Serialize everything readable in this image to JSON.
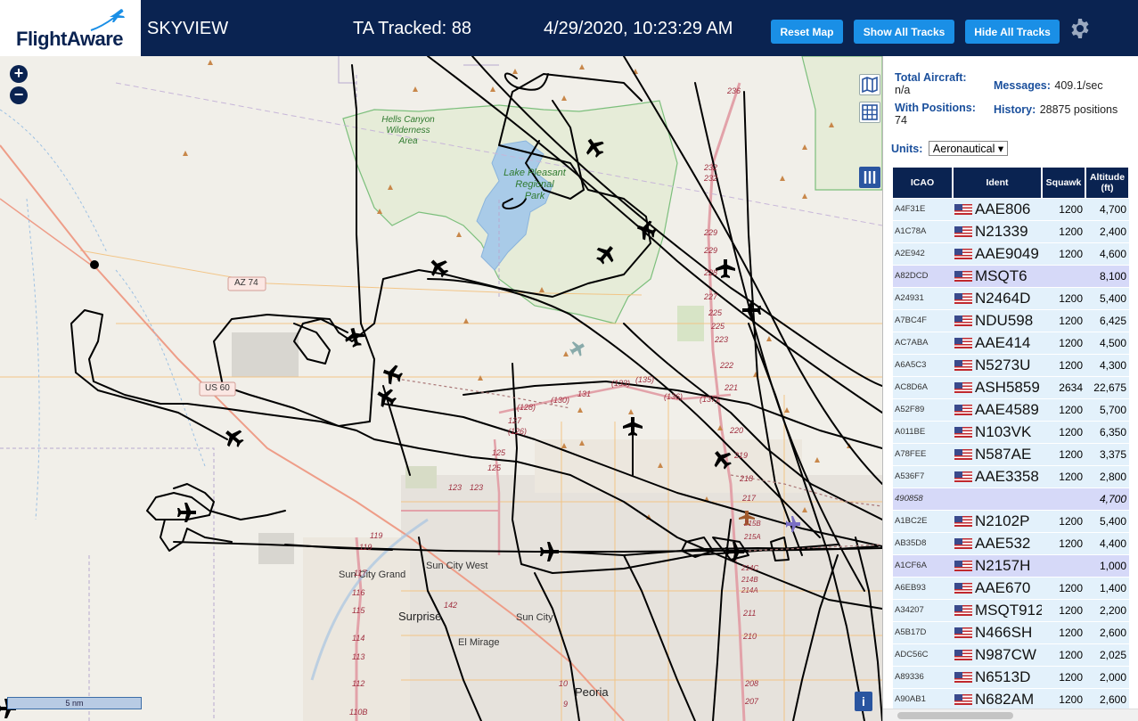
{
  "header": {
    "logo": "FlightAware",
    "title": "SKYVIEW",
    "ta_tracked": "TA Tracked: 88",
    "datetime": "4/29/2020, 10:23:29 AM",
    "reset_map": "Reset Map",
    "show_all_tracks": "Show All Tracks",
    "hide_all_tracks": "Hide All Tracks",
    "settings_icon": "gear-icon"
  },
  "map": {
    "zoom_in": "+",
    "zoom_out": "−",
    "scale_label": "5 nm",
    "info": "i",
    "labels": {
      "hells_canyon_1": "Hells Canyon",
      "hells_canyon_2": "Wilderness",
      "hells_canyon_3": "Area",
      "lake_1": "Lake Pleasant",
      "lake_2": "Regional",
      "lake_3": "Park",
      "az74": "AZ 74",
      "us60": "US 60",
      "sun_city_west": "Sun City West",
      "sun_city_grand": "Sun City Grand",
      "surprise": "Surprise",
      "sun_city": "Sun City",
      "el_mirage": "El Mirage",
      "peoria": "Peoria"
    },
    "road_numbers": [
      "236",
      "232",
      "232",
      "229",
      "229",
      "228",
      "227",
      "225",
      "225",
      "223",
      "222",
      "221",
      "220",
      "219",
      "218",
      "217",
      "215B",
      "215A",
      "214C",
      "214B",
      "214A",
      "211",
      "210",
      "208",
      "207",
      "131",
      "(130)",
      "(133)",
      "(135)",
      "(136)",
      "(137)",
      "(128)",
      "127",
      "(126)",
      "125",
      "125",
      "123",
      "123",
      "119",
      "119",
      "117",
      "116",
      "115",
      "114",
      "113",
      "112",
      "110B",
      "142",
      "10",
      "9"
    ]
  },
  "sidebar": {
    "total_aircraft_label": "Total Aircraft:",
    "total_aircraft_value": "n/a",
    "with_positions_label": "With Positions:",
    "with_positions_value": "74",
    "messages_label": "Messages:",
    "messages_value": "409.1/sec",
    "history_label": "History:",
    "history_value": "28875 positions",
    "units_label": "Units:",
    "units_value": "Aeronautical"
  },
  "table": {
    "columns": [
      "ICAO",
      "Ident",
      "Squawk",
      "Altitude (ft)"
    ],
    "rows": [
      {
        "icao": "A4F31E",
        "ident": "AAE806",
        "squawk": "1200",
        "alt": "4,700"
      },
      {
        "icao": "A1C78A",
        "ident": "N21339",
        "squawk": "1200",
        "alt": "2,400"
      },
      {
        "icao": "A2E942",
        "ident": "AAE9049",
        "squawk": "1200",
        "alt": "4,600"
      },
      {
        "icao": "A82DCD",
        "ident": "MSQT6",
        "squawk": "",
        "alt": "8,100"
      },
      {
        "icao": "A24931",
        "ident": "N2464D",
        "squawk": "1200",
        "alt": "5,400"
      },
      {
        "icao": "A7BC4F",
        "ident": "NDU598",
        "squawk": "1200",
        "alt": "6,425"
      },
      {
        "icao": "AC7ABA",
        "ident": "AAE414",
        "squawk": "1200",
        "alt": "4,500"
      },
      {
        "icao": "A6A5C3",
        "ident": "N5273U",
        "squawk": "1200",
        "alt": "4,300"
      },
      {
        "icao": "AC8D6A",
        "ident": "ASH5859",
        "squawk": "2634",
        "alt": "22,675"
      },
      {
        "icao": "A52F89",
        "ident": "AAE4589",
        "squawk": "1200",
        "alt": "5,700"
      },
      {
        "icao": "A011BE",
        "ident": "N103VK",
        "squawk": "1200",
        "alt": "6,350"
      },
      {
        "icao": "A78FEE",
        "ident": "N587AE",
        "squawk": "1200",
        "alt": "3,375"
      },
      {
        "icao": "A536F7",
        "ident": "AAE3358",
        "squawk": "1200",
        "alt": "2,800"
      },
      {
        "icao": "490858",
        "ident": "",
        "squawk": "",
        "alt": "4,700"
      },
      {
        "icao": "A1BC2E",
        "ident": "N2102P",
        "squawk": "1200",
        "alt": "5,400"
      },
      {
        "icao": "AB35D8",
        "ident": "AAE532",
        "squawk": "1200",
        "alt": "4,400"
      },
      {
        "icao": "A1CF6A",
        "ident": "N2157H",
        "squawk": "",
        "alt": "1,000"
      },
      {
        "icao": "A6EB93",
        "ident": "AAE670",
        "squawk": "1200",
        "alt": "1,400"
      },
      {
        "icao": "A34207",
        "ident": "MSQT912",
        "squawk": "1200",
        "alt": "2,200"
      },
      {
        "icao": "A5B17D",
        "ident": "N466SH",
        "squawk": "1200",
        "alt": "2,600"
      },
      {
        "icao": "ADC56C",
        "ident": "N987CW",
        "squawk": "1200",
        "alt": "2,025"
      },
      {
        "icao": "A89336",
        "ident": "N6513D",
        "squawk": "1200",
        "alt": "2,000"
      },
      {
        "icao": "A90AB1",
        "ident": "N682AM",
        "squawk": "1200",
        "alt": "2,600"
      }
    ]
  }
}
